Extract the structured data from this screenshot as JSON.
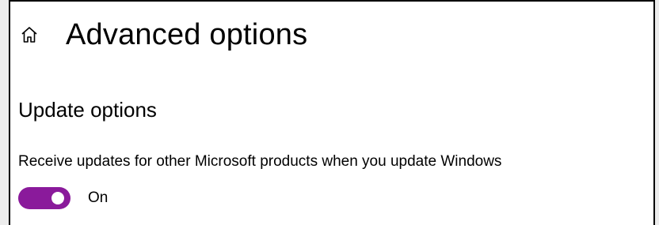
{
  "window": {
    "title": "Advanced options"
  },
  "header": {
    "home_icon": "home-icon"
  },
  "sections": {
    "update_options": {
      "title": "Update options",
      "setting": {
        "label": "Receive updates for other Microsoft products when you update Windows",
        "state_label": "On",
        "checked": true
      }
    }
  },
  "colors": {
    "accent": "#8a1a9b",
    "text": "#000000",
    "background": "#ffffff"
  }
}
